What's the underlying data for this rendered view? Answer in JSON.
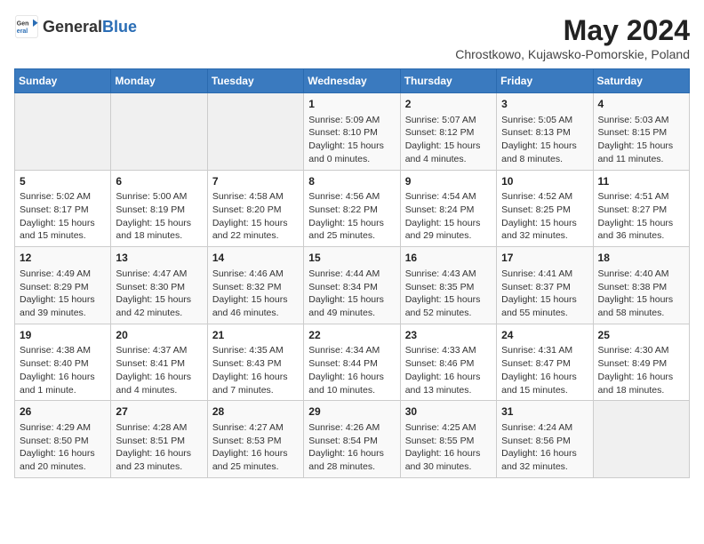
{
  "header": {
    "logo_general": "General",
    "logo_blue": "Blue",
    "month_title": "May 2024",
    "location": "Chrostkowo, Kujawsko-Pomorskie, Poland"
  },
  "days_of_week": [
    "Sunday",
    "Monday",
    "Tuesday",
    "Wednesday",
    "Thursday",
    "Friday",
    "Saturday"
  ],
  "weeks": [
    [
      {
        "day": "",
        "info": ""
      },
      {
        "day": "",
        "info": ""
      },
      {
        "day": "",
        "info": ""
      },
      {
        "day": "1",
        "info": "Sunrise: 5:09 AM\nSunset: 8:10 PM\nDaylight: 15 hours\nand 0 minutes."
      },
      {
        "day": "2",
        "info": "Sunrise: 5:07 AM\nSunset: 8:12 PM\nDaylight: 15 hours\nand 4 minutes."
      },
      {
        "day": "3",
        "info": "Sunrise: 5:05 AM\nSunset: 8:13 PM\nDaylight: 15 hours\nand 8 minutes."
      },
      {
        "day": "4",
        "info": "Sunrise: 5:03 AM\nSunset: 8:15 PM\nDaylight: 15 hours\nand 11 minutes."
      }
    ],
    [
      {
        "day": "5",
        "info": "Sunrise: 5:02 AM\nSunset: 8:17 PM\nDaylight: 15 hours\nand 15 minutes."
      },
      {
        "day": "6",
        "info": "Sunrise: 5:00 AM\nSunset: 8:19 PM\nDaylight: 15 hours\nand 18 minutes."
      },
      {
        "day": "7",
        "info": "Sunrise: 4:58 AM\nSunset: 8:20 PM\nDaylight: 15 hours\nand 22 minutes."
      },
      {
        "day": "8",
        "info": "Sunrise: 4:56 AM\nSunset: 8:22 PM\nDaylight: 15 hours\nand 25 minutes."
      },
      {
        "day": "9",
        "info": "Sunrise: 4:54 AM\nSunset: 8:24 PM\nDaylight: 15 hours\nand 29 minutes."
      },
      {
        "day": "10",
        "info": "Sunrise: 4:52 AM\nSunset: 8:25 PM\nDaylight: 15 hours\nand 32 minutes."
      },
      {
        "day": "11",
        "info": "Sunrise: 4:51 AM\nSunset: 8:27 PM\nDaylight: 15 hours\nand 36 minutes."
      }
    ],
    [
      {
        "day": "12",
        "info": "Sunrise: 4:49 AM\nSunset: 8:29 PM\nDaylight: 15 hours\nand 39 minutes."
      },
      {
        "day": "13",
        "info": "Sunrise: 4:47 AM\nSunset: 8:30 PM\nDaylight: 15 hours\nand 42 minutes."
      },
      {
        "day": "14",
        "info": "Sunrise: 4:46 AM\nSunset: 8:32 PM\nDaylight: 15 hours\nand 46 minutes."
      },
      {
        "day": "15",
        "info": "Sunrise: 4:44 AM\nSunset: 8:34 PM\nDaylight: 15 hours\nand 49 minutes."
      },
      {
        "day": "16",
        "info": "Sunrise: 4:43 AM\nSunset: 8:35 PM\nDaylight: 15 hours\nand 52 minutes."
      },
      {
        "day": "17",
        "info": "Sunrise: 4:41 AM\nSunset: 8:37 PM\nDaylight: 15 hours\nand 55 minutes."
      },
      {
        "day": "18",
        "info": "Sunrise: 4:40 AM\nSunset: 8:38 PM\nDaylight: 15 hours\nand 58 minutes."
      }
    ],
    [
      {
        "day": "19",
        "info": "Sunrise: 4:38 AM\nSunset: 8:40 PM\nDaylight: 16 hours\nand 1 minute."
      },
      {
        "day": "20",
        "info": "Sunrise: 4:37 AM\nSunset: 8:41 PM\nDaylight: 16 hours\nand 4 minutes."
      },
      {
        "day": "21",
        "info": "Sunrise: 4:35 AM\nSunset: 8:43 PM\nDaylight: 16 hours\nand 7 minutes."
      },
      {
        "day": "22",
        "info": "Sunrise: 4:34 AM\nSunset: 8:44 PM\nDaylight: 16 hours\nand 10 minutes."
      },
      {
        "day": "23",
        "info": "Sunrise: 4:33 AM\nSunset: 8:46 PM\nDaylight: 16 hours\nand 13 minutes."
      },
      {
        "day": "24",
        "info": "Sunrise: 4:31 AM\nSunset: 8:47 PM\nDaylight: 16 hours\nand 15 minutes."
      },
      {
        "day": "25",
        "info": "Sunrise: 4:30 AM\nSunset: 8:49 PM\nDaylight: 16 hours\nand 18 minutes."
      }
    ],
    [
      {
        "day": "26",
        "info": "Sunrise: 4:29 AM\nSunset: 8:50 PM\nDaylight: 16 hours\nand 20 minutes."
      },
      {
        "day": "27",
        "info": "Sunrise: 4:28 AM\nSunset: 8:51 PM\nDaylight: 16 hours\nand 23 minutes."
      },
      {
        "day": "28",
        "info": "Sunrise: 4:27 AM\nSunset: 8:53 PM\nDaylight: 16 hours\nand 25 minutes."
      },
      {
        "day": "29",
        "info": "Sunrise: 4:26 AM\nSunset: 8:54 PM\nDaylight: 16 hours\nand 28 minutes."
      },
      {
        "day": "30",
        "info": "Sunrise: 4:25 AM\nSunset: 8:55 PM\nDaylight: 16 hours\nand 30 minutes."
      },
      {
        "day": "31",
        "info": "Sunrise: 4:24 AM\nSunset: 8:56 PM\nDaylight: 16 hours\nand 32 minutes."
      },
      {
        "day": "",
        "info": ""
      }
    ]
  ]
}
